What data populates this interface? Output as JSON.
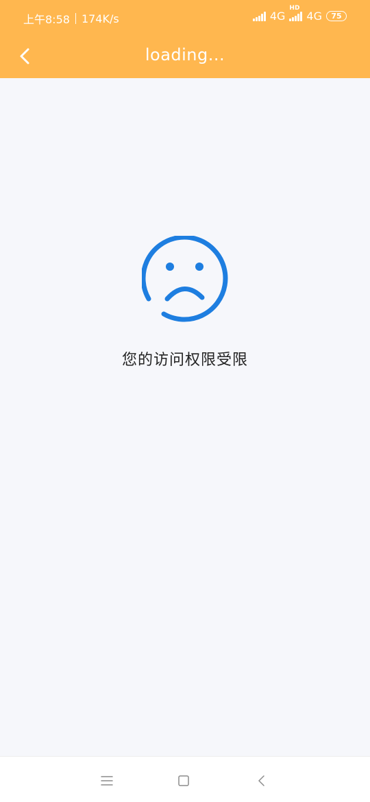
{
  "status_bar": {
    "time": "上午8:58",
    "speed": "174K/s",
    "network1": "4G",
    "network2": "4G",
    "network2_badge": "HD",
    "battery": "75"
  },
  "header": {
    "title": "loading..."
  },
  "content": {
    "message": "您的访问权限受限"
  },
  "colors": {
    "header_bg": "#ffb74f",
    "icon_blue": "#1e7ee0",
    "page_bg": "#f6f7fb"
  },
  "icons": {
    "back": "chevron-left-icon",
    "face": "sad-face-icon",
    "menu": "menu-icon",
    "home": "home-icon",
    "sys_back": "back-icon"
  }
}
